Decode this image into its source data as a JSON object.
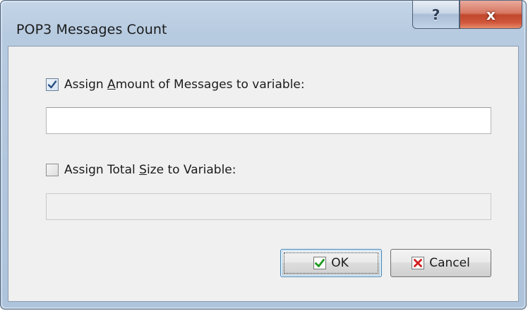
{
  "window": {
    "title": "POP3 Messages Count",
    "help_glyph": "?",
    "close_glyph": "x"
  },
  "amount_option": {
    "label_before": "Assign ",
    "label_mnemonic": "A",
    "label_after": "mount of Messages to variable:",
    "checked": true,
    "input_value": "",
    "enabled": true
  },
  "size_option": {
    "label_before": "Assign Total ",
    "label_mnemonic": "S",
    "label_after": "ize to Variable:",
    "checked": false,
    "input_value": "",
    "enabled": false
  },
  "buttons": {
    "ok_label": "OK",
    "cancel_label": "Cancel",
    "ok_icon": "checkmark-icon",
    "cancel_icon": "x-mark-icon"
  },
  "colors": {
    "titlebar": "#b9cce2",
    "close_button": "#c8502f",
    "check_mark": "#2a4f86",
    "ok_icon": "#1f9b1f",
    "cancel_icon": "#d41f1f"
  }
}
